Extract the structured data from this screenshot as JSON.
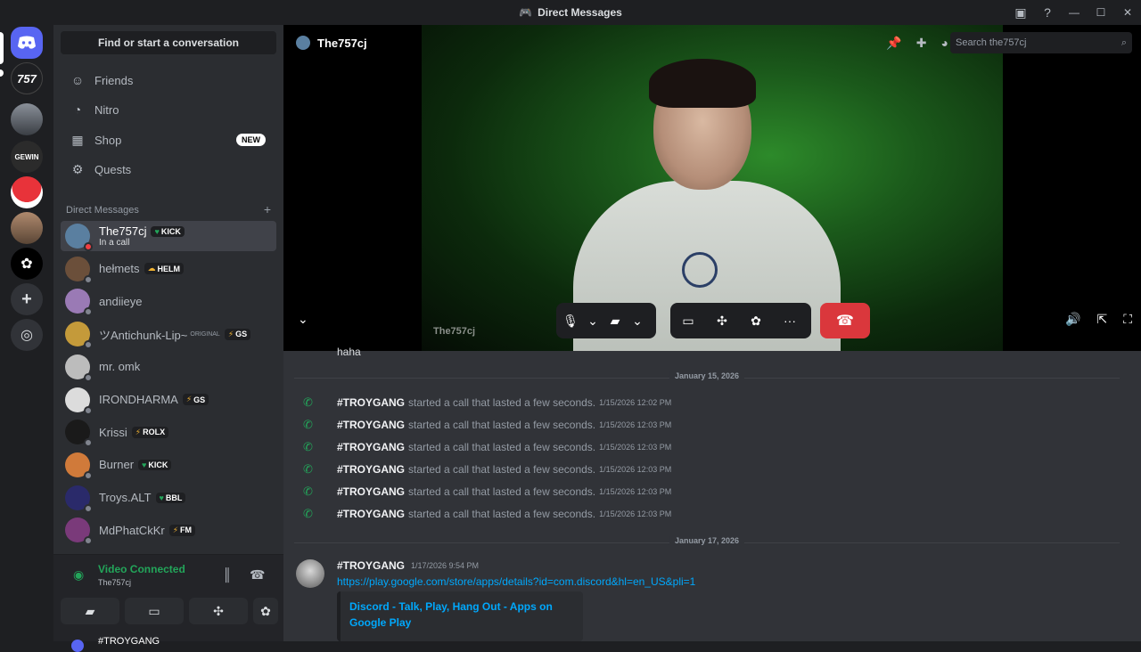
{
  "window": {
    "title": "Direct Messages"
  },
  "guilds": [
    {
      "name": "discord-home",
      "label": "",
      "color": "#5865f2"
    },
    {
      "name": "the757cj-server",
      "label": "757",
      "color": "#1e1f22"
    },
    {
      "name": "car-server",
      "label": "",
      "color": "#5a5f66"
    },
    {
      "name": "gewin-squad-server",
      "label": "",
      "color": "#2b2b2b"
    },
    {
      "name": "mushroom-server",
      "label": "",
      "color": "#c0262b"
    },
    {
      "name": "avatar-server",
      "label": "",
      "color": "#8a6a55"
    },
    {
      "name": "paw-server",
      "label": "",
      "color": "#000000"
    }
  ],
  "sidebar": {
    "find_label": "Find or start a conversation",
    "nav": [
      {
        "label": "Friends",
        "icon": "friends-icon"
      },
      {
        "label": "Nitro",
        "icon": "nitro-icon"
      },
      {
        "label": "Shop",
        "icon": "shop-icon",
        "badge": "NEW"
      },
      {
        "label": "Quests",
        "icon": "quests-icon"
      }
    ],
    "dm_header": "Direct Messages",
    "dms": [
      {
        "name": "The757cj",
        "tag": "KICK",
        "tag_icon": "♥",
        "sub": "In a call",
        "color": "#5a7fa0",
        "status": "#f23f43",
        "active": true
      },
      {
        "name": "hełmets",
        "tag": "HELM",
        "tag_icon": "☁",
        "color": "#6b4f3a",
        "status": "#80848e"
      },
      {
        "name": "andiieye",
        "tag": "",
        "color": "#9a7ab5",
        "status": "#80848e"
      },
      {
        "name": "ツAntichunk-Lip~",
        "tag": "GS",
        "tag_icon": "⚡",
        "color": "#c49a3a",
        "status": "#80848e",
        "extra": "ORIGINAL"
      },
      {
        "name": "mr. omk",
        "tag": "",
        "color": "#bcbcbc",
        "status": "#80848e"
      },
      {
        "name": "IRONDHARMA",
        "tag": "GS",
        "tag_icon": "⚡",
        "color": "#dcdcdc",
        "status": "#80848e"
      },
      {
        "name": "Krissi",
        "tag": "ROLX",
        "tag_icon": "⚡",
        "color": "#1a1a1a",
        "status": "#80848e"
      },
      {
        "name": "Burner",
        "tag": "KICK",
        "tag_icon": "♥",
        "color": "#d07a3a",
        "status": "#80848e"
      },
      {
        "name": "Troys.ALT",
        "tag": "BBL",
        "tag_icon": "♥",
        "color": "#2a2a6a",
        "status": "#80848e"
      },
      {
        "name": "MdPhatCkKr",
        "tag": "FM",
        "tag_icon": "⚡",
        "color": "#7a3a7a",
        "status": "#80848e"
      }
    ],
    "voice": {
      "title": "Video Connected",
      "sub": "The757cj"
    },
    "partial_user": "#TROYGANG"
  },
  "call": {
    "name": "The757cj",
    "video_label": "The757cj",
    "search_placeholder": "Search the757cj"
  },
  "messages": {
    "partial_top": "haha",
    "date1": "January 15, 2026",
    "calls": [
      {
        "user": "#TROYGANG",
        "text": "started a call that lasted a few seconds.",
        "time": "1/15/2026 12:02 PM"
      },
      {
        "user": "#TROYGANG",
        "text": "started a call that lasted a few seconds.",
        "time": "1/15/2026 12:03 PM"
      },
      {
        "user": "#TROYGANG",
        "text": "started a call that lasted a few seconds.",
        "time": "1/15/2026 12:03 PM"
      },
      {
        "user": "#TROYGANG",
        "text": "started a call that lasted a few seconds.",
        "time": "1/15/2026 12:03 PM"
      },
      {
        "user": "#TROYGANG",
        "text": "started a call that lasted a few seconds.",
        "time": "1/15/2026 12:03 PM"
      },
      {
        "user": "#TROYGANG",
        "text": "started a call that lasted a few seconds.",
        "time": "1/15/2026 12:03 PM"
      }
    ],
    "date2": "January 17, 2026",
    "post": {
      "user": "#TROYGANG",
      "time": "1/17/2026 9:54 PM",
      "link": "https://play.google.com/store/apps/details?id=com.discord&hl=en_US&pli=1",
      "embed_title": "Discord - Talk, Play, Hang Out - Apps on Google Play"
    }
  }
}
